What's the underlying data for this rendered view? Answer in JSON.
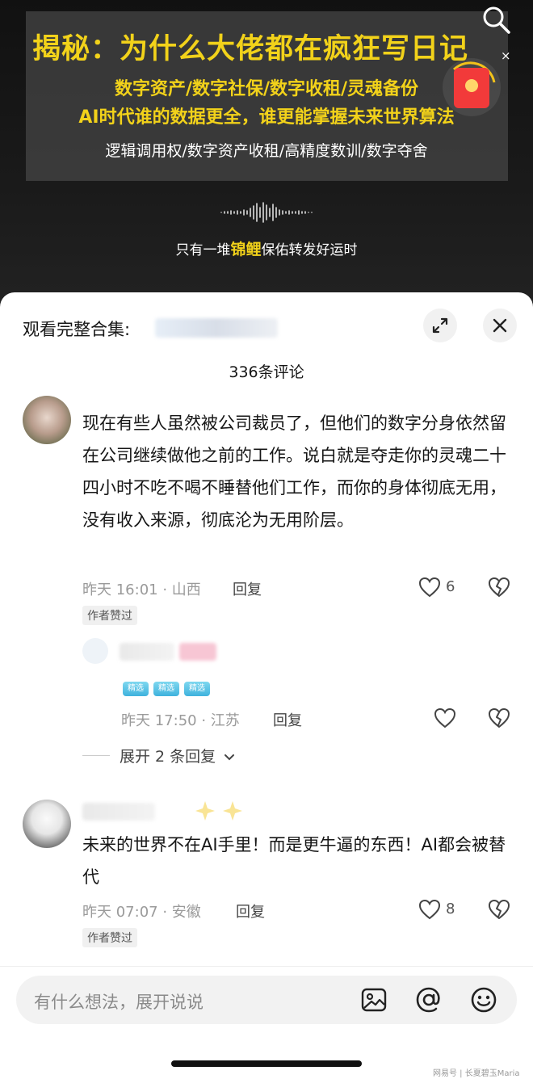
{
  "video": {
    "title": "揭秘：为什么大佬都在疯狂写日记",
    "subtitle_1": "数字资产/数字社保/数字收租/灵魂备份",
    "subtitle_2": "AI时代谁的数据更全，谁更能掌握未来世界算法",
    "subtitle_3": "逻辑调用权/数字资产收租/高精度数训/数字夺舍",
    "caption_before": "只有一堆",
    "caption_highlight": "锦鲤",
    "caption_after": "保佑转发好运时",
    "close_label": "×"
  },
  "sheet": {
    "collection_label": "观看完整合集:",
    "comment_count": "336条评论"
  },
  "comments": [
    {
      "text": "现在有些人虽然被公司裁员了，但他们的数字分身依然留在公司继续做他之前的工作。说白就是夺走你的灵魂二十四小时不吃不喝不睡替他们工作，而你的身体彻底无用，没有收入来源，彻底沦为无用阶层。",
      "meta": "昨天 16:01 · 山西",
      "reply_label": "回复",
      "tag": "作者赞过",
      "likes": "6"
    },
    {
      "text": "未来的世界不在AI手里！而是更牛逼的东西！AI都会被替代",
      "meta": "昨天 07:07 · 安徽",
      "reply_label": "回复",
      "tag": "作者赞过",
      "likes": "8"
    }
  ],
  "sub_reply": {
    "badges": [
      "精选",
      "精选",
      "精选"
    ],
    "meta": "昨天 17:50 · 江苏",
    "reply_label": "回复",
    "expand_label": "展开 2 条回复"
  },
  "input": {
    "placeholder": "有什么想法，展开说说"
  },
  "watermark": "网易号 | 长夏碧玉Maria",
  "colors": {
    "accent_yellow": "#f2d21a",
    "red_packet": "#f23a3a"
  }
}
